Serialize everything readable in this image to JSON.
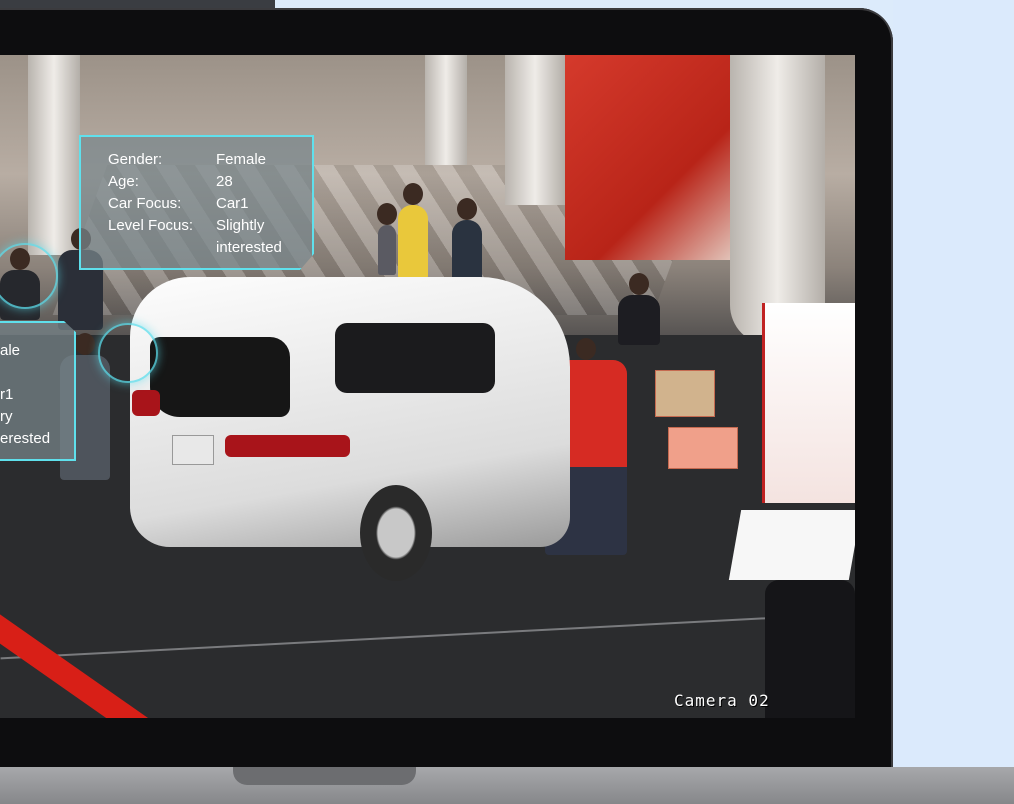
{
  "overlay": {
    "main_panel": {
      "rows": [
        {
          "label": "Gender:",
          "value": "Female"
        },
        {
          "label": "Age:",
          "value": "28"
        },
        {
          "label": "Car Focus:",
          "value": "Car1"
        },
        {
          "label": "Level Focus:",
          "value": "Slightly"
        },
        {
          "label": "",
          "value": "interested"
        }
      ]
    },
    "side_panel": {
      "rows": [
        "ale",
        "",
        "r1",
        "ry",
        "erested"
      ]
    },
    "accent_color": "#5fe0ec"
  },
  "camera": {
    "label": "Camera 02"
  },
  "colors": {
    "background": "#dcebfb",
    "laptop_bezel": "#0d0d0f",
    "laptop_base": "#a7a8ab"
  }
}
